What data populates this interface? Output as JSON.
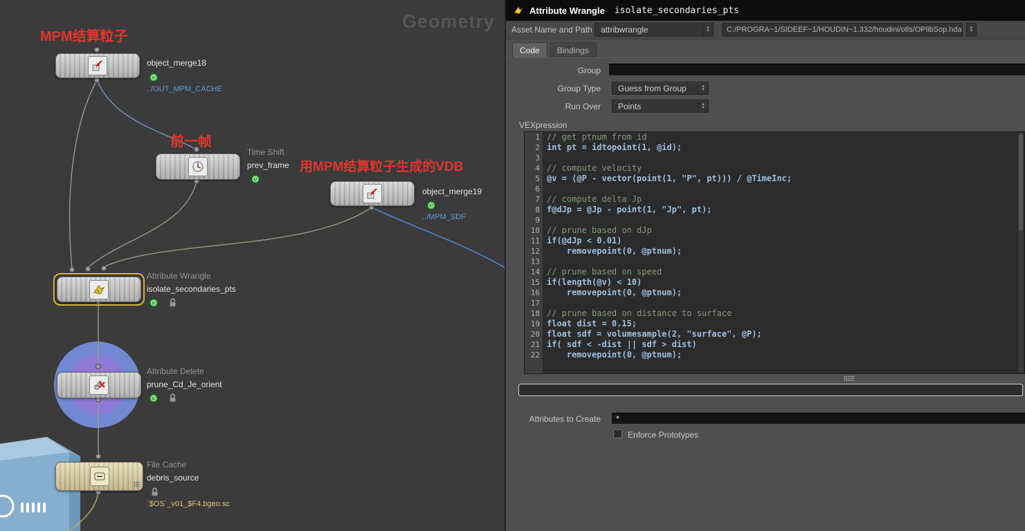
{
  "colors": {
    "annotation_red": "#e2352b",
    "node_select_yellow": "#d9b63b",
    "wire_blue": "#4f86d0",
    "wire_gray": "#93a089",
    "reference_blue": "#5f9ed8",
    "file_path_yellow": "#d9c87c",
    "badge_green": "#2f9e2f"
  },
  "network": {
    "pane_label": "Geometry",
    "annotations": {
      "mpm_particles": "MPM结算粒子",
      "prev_frame": "前一帧",
      "vdb_from_mpm": "用MPM结算粒子生成的VDB"
    },
    "nodes": {
      "object_merge18": {
        "name": "object_merge18",
        "comment": "../OUT_MPM_CACHE"
      },
      "prev_frame": {
        "type": "Time Shift",
        "name": "prev_frame"
      },
      "object_merge19": {
        "name": "object_merge19",
        "comment": "../MPM_SDF"
      },
      "wrangle": {
        "type": "Attribute Wrangle",
        "name": "isolate_secondaries_pts"
      },
      "delete": {
        "type": "Attribute Delete",
        "name": "prune_Cd_Je_orient"
      },
      "cache": {
        "type": "File Cache",
        "name": "debris_source",
        "comment": "`$OS`_v01_$F4.bgeo.sc"
      }
    }
  },
  "params": {
    "header": {
      "title": "Attribute Wrangle",
      "node_name": "isolate_secondaries_pts"
    },
    "asset_row": {
      "label": "Asset Name and Path",
      "type_value": "attribwrangle",
      "path_value": "C:/PROGRA~1/SIDEEF~1/HOUDIN~1.332/houdini/otls/OPlibSop.hda"
    },
    "tabs": {
      "code": "Code",
      "bindings": "Bindings"
    },
    "group": {
      "label": "Group",
      "value": ""
    },
    "group_type": {
      "label": "Group Type",
      "value": "Guess from Group"
    },
    "run_over": {
      "label": "Run Over",
      "value": "Points"
    },
    "vex_label": "VEXpression",
    "snippet_value": "",
    "attributes": {
      "label": "Attributes to Create",
      "value": "*"
    },
    "enforce": {
      "label": "Enforce Prototypes",
      "checked": false
    },
    "code": {
      "lines": [
        {
          "n": 1,
          "kind": "comment",
          "text": "// get ptnum from id"
        },
        {
          "n": 2,
          "kind": "code",
          "text": "int pt = idtopoint(1, @id);"
        },
        {
          "n": 3,
          "kind": "blank",
          "text": ""
        },
        {
          "n": 4,
          "kind": "comment",
          "text": "// compute velocity"
        },
        {
          "n": 5,
          "kind": "code",
          "text": "@v = (@P - vector(point(1, \"P\", pt))) / @TimeInc;"
        },
        {
          "n": 6,
          "kind": "blank",
          "text": ""
        },
        {
          "n": 7,
          "kind": "comment",
          "text": "// compute delta Jp"
        },
        {
          "n": 8,
          "kind": "code",
          "text": "f@dJp = @Jp - point(1, \"Jp\", pt);"
        },
        {
          "n": 9,
          "kind": "blank",
          "text": ""
        },
        {
          "n": 10,
          "kind": "comment",
          "text": "// prune based on dJp"
        },
        {
          "n": 11,
          "kind": "code",
          "text": "if(@dJp < 0.01)"
        },
        {
          "n": 12,
          "kind": "code",
          "text": "    removepoint(0, @ptnum);"
        },
        {
          "n": 13,
          "kind": "blank",
          "text": ""
        },
        {
          "n": 14,
          "kind": "comment",
          "text": "// prune based on speed"
        },
        {
          "n": 15,
          "kind": "code",
          "text": "if(length(@v) < 10)"
        },
        {
          "n": 16,
          "kind": "code",
          "text": "    removepoint(0, @ptnum);"
        },
        {
          "n": 17,
          "kind": "blank",
          "text": ""
        },
        {
          "n": 18,
          "kind": "comment",
          "text": "// prune based on distance to surface"
        },
        {
          "n": 19,
          "kind": "code",
          "text": "float dist = 0.15;"
        },
        {
          "n": 20,
          "kind": "code",
          "text": "float sdf = volumesample(2, \"surface\", @P);"
        },
        {
          "n": 21,
          "kind": "code",
          "text": "if( sdf < -dist || sdf > dist)"
        },
        {
          "n": 22,
          "kind": "code",
          "text": "    removepoint(0, @ptnum);"
        }
      ]
    }
  }
}
